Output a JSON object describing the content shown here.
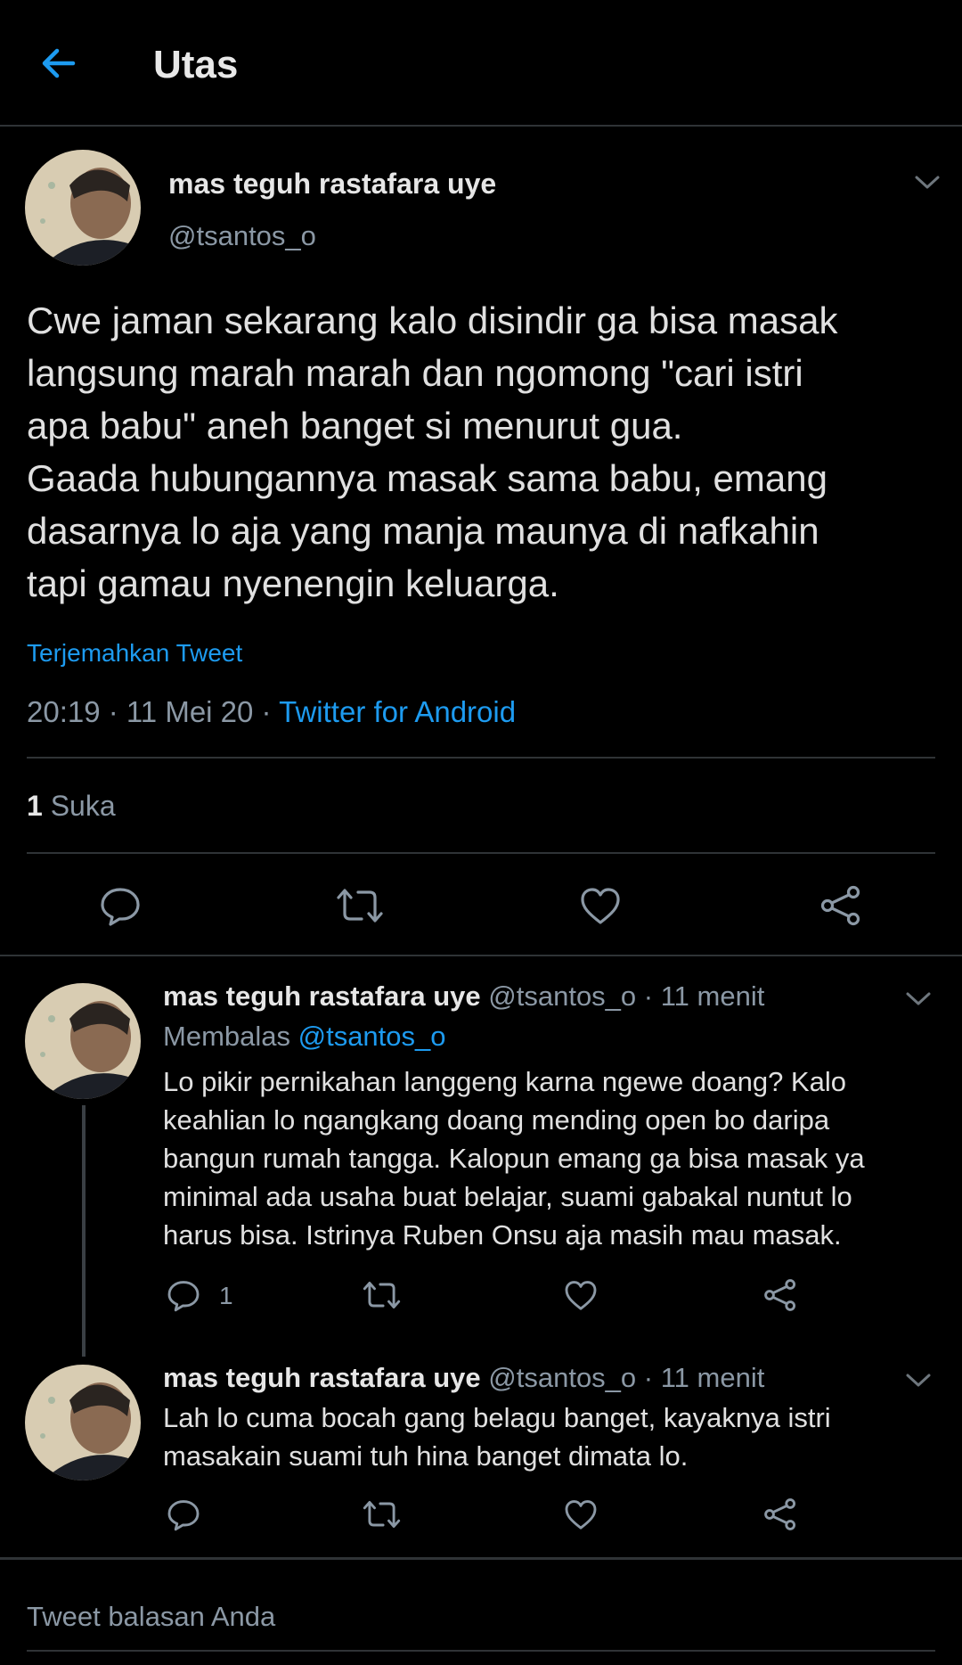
{
  "header": {
    "title": "Utas"
  },
  "tweet": {
    "author_name": "mas teguh rastafara uye",
    "author_handle": "@tsantos_o",
    "text": "Cwe jaman sekarang kalo disindir ga bisa masak\nlangsung marah marah dan ngomong \"cari istri\napa babu\" aneh banget si menurut gua.\nGaada hubungannya masak sama babu, emang\ndasarnya lo aja yang manja maunya di nafkahin\ntapi gamau nyenengin keluarga.",
    "translate_label": "Terjemahkan Tweet",
    "time": "20:19 · 11 Mei 20 · ",
    "source": "Twitter for Android",
    "likes_count": "1",
    "likes_label": " Suka"
  },
  "replies": [
    {
      "author_name": "mas teguh rastafara uye",
      "meta": " @tsantos_o · 11 menit",
      "replying_label": "Membalas ",
      "replying_to": "@tsantos_o",
      "text": "Lo pikir pernikahan langgeng karna ngewe doang? Kalo\nkeahlian lo ngangkang doang mending open bo daripa\nbangun rumah tangga. Kalopun emang ga bisa masak ya\nminimal ada usaha buat belajar, suami gabakal nuntut lo\nharus bisa. Istrinya Ruben Onsu aja masih mau masak.",
      "reply_count": "1"
    },
    {
      "author_name": "mas teguh rastafara uye",
      "meta": " @tsantos_o · 11 menit",
      "text": "Lah lo cuma bocah gang belagu banget, kayaknya istri\nmasakain suami tuh hina banget dimata lo."
    }
  ],
  "compose": {
    "placeholder": "Tweet balasan Anda"
  },
  "icons": {
    "back": "arrow-left-icon",
    "reply": "speech-bubble-icon",
    "retweet": "retweet-icon",
    "like": "heart-icon",
    "share": "share-icon",
    "more": "chevron-down-icon"
  },
  "colors": {
    "accent": "#1d9bf0",
    "background": "#000000",
    "muted": "#8b98a5"
  }
}
